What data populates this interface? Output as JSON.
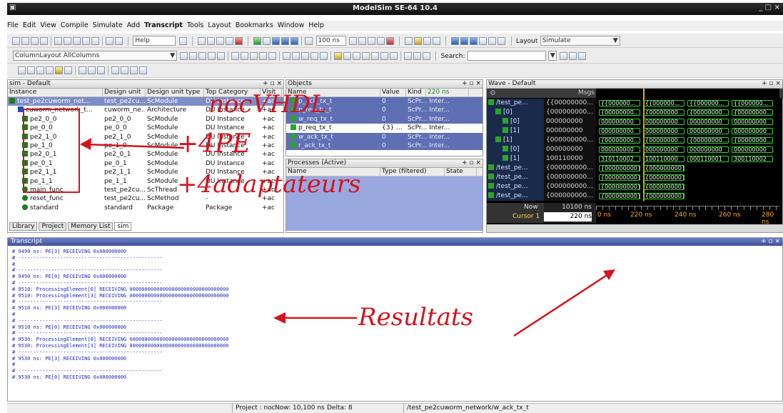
{
  "window": {
    "title": "ModelSim SE-64 10.4",
    "controls": "_ □ ×"
  },
  "menu": [
    "File",
    "Edit",
    "View",
    "Compile",
    "Simulate",
    "Add",
    "Transcript",
    "Tools",
    "Layout",
    "Bookmarks",
    "Window",
    "Help"
  ],
  "toolbar": {
    "help_label": "Help",
    "runtime_value": "100 ns",
    "layout_label": "Layout",
    "layout_value": "Simulate",
    "column_layout_value": "ColumnLayout AllColumns",
    "search_label": "Search:"
  },
  "sim_pane": {
    "title": "sim - Default",
    "columns": [
      "Instance",
      "Design unit",
      "Design unit type",
      "Top Category",
      "Visit"
    ],
    "rows": [
      {
        "instance": "test_pe2cuworm_net...",
        "unit": "test_pe2cu...",
        "type": "ScModule",
        "cat": "DU Instance",
        "vis": "+ac"
      },
      {
        "instance": "cuworm_network_t...",
        "unit": "cuworm_ne...",
        "type": "Architecture",
        "cat": "DU Instance",
        "vis": "+ac"
      },
      {
        "instance": "pe2_0_0",
        "unit": "pe2_0_0",
        "type": "ScModule",
        "cat": "DU Instance",
        "vis": "+ac"
      },
      {
        "instance": "pe_0_0",
        "unit": "pe_0_0",
        "type": "ScModule",
        "cat": "DU Instance",
        "vis": "+ac"
      },
      {
        "instance": "pe2_1_0",
        "unit": "pe2_1_0",
        "type": "ScModule",
        "cat": "DU Instance",
        "vis": "+ac"
      },
      {
        "instance": "pe_1_0",
        "unit": "pe_1_0",
        "type": "ScModule",
        "cat": "DU Instance",
        "vis": "+ac"
      },
      {
        "instance": "pe2_0_1",
        "unit": "pe2_0_1",
        "type": "ScModule",
        "cat": "DU Instance",
        "vis": "+ac"
      },
      {
        "instance": "pe_0_1",
        "unit": "pe_0_1",
        "type": "ScModule",
        "cat": "DU Instance",
        "vis": "+ac"
      },
      {
        "instance": "pe2_1_1",
        "unit": "pe2_1_1",
        "type": "ScModule",
        "cat": "DU Instance",
        "vis": "+ac"
      },
      {
        "instance": "pe_1_1",
        "unit": "pe_1_1",
        "type": "ScModule",
        "cat": "DU Instance",
        "vis": "+ac"
      },
      {
        "instance": "main_func",
        "unit": "test_pe2cu...",
        "type": "ScThread",
        "cat": "-",
        "vis": "+ac"
      },
      {
        "instance": "reset_func",
        "unit": "test_pe2cu...",
        "type": "ScMethod",
        "cat": "-",
        "vis": "+ac"
      },
      {
        "instance": "standard",
        "unit": "standard",
        "type": "Package",
        "cat": "Package",
        "vis": "+ac"
      }
    ],
    "tabs": [
      "Library",
      "Project",
      "Memory List",
      "sim"
    ]
  },
  "objects_pane": {
    "title": "Objects",
    "columns": [
      "Name",
      "Value",
      "Kind"
    ],
    "now": "220 ns",
    "rows": [
      {
        "name": "p_ack_tx_t",
        "value": "0",
        "kind": "ScPr... Inter..."
      },
      {
        "name": "p_req_tx_t",
        "value": "0",
        "kind": "ScPr... Inter..."
      },
      {
        "name": "w_req_tx_t",
        "value": "0",
        "kind": "ScPr... Inter..."
      },
      {
        "name": "p_req_tx_t",
        "value": "{3} ...",
        "kind": "ScPr... Inter..."
      },
      {
        "name": "w_ack_tx_t",
        "value": "0",
        "kind": "ScPr... Inter..."
      },
      {
        "name": "r_ack_tx_t",
        "value": "0",
        "kind": "ScPr... Inter..."
      }
    ]
  },
  "processes_pane": {
    "title": "Processes (Active)",
    "columns": [
      "Name",
      "Type (filtered)",
      "State"
    ]
  },
  "wave_pane": {
    "title": "Wave - Default",
    "msgs_label": "Msgs",
    "signals": [
      {
        "name": "/test_pe...",
        "value": "{{00000000..."
      },
      {
        "name": "[0]",
        "value": "{000000000..."
      },
      {
        "name": "[0]",
        "value": "000000000"
      },
      {
        "name": "[1]",
        "value": "000000000"
      },
      {
        "name": "[1]",
        "value": "{000000000..."
      },
      {
        "name": "[0]",
        "value": "000000000"
      },
      {
        "name": "[1]",
        "value": "100110000"
      },
      {
        "name": "/test_pe...",
        "value": "{000000000..."
      },
      {
        "name": "/test_pe...",
        "value": "{000000000..."
      },
      {
        "name": "/test_pe...",
        "value": "{000000000..."
      },
      {
        "name": "/test_pe...",
        "value": "{000000000..."
      }
    ],
    "wave_values": [
      [
        "{{000000...",
        "{{000000...",
        "{{000000...",
        "{{000000..."
      ],
      [
        "{00000000...",
        "{00000000...",
        "{00000000...",
        "{00000000..."
      ],
      [
        "000000000",
        "000000000",
        "000000000",
        "000000000"
      ],
      [
        "000000000",
        "000000000",
        "000000000",
        "000000000"
      ],
      [
        "{00000000...",
        "{00000000...",
        "{00000000...",
        "{00000000..."
      ],
      [
        "000000000",
        "000000000",
        "000000000",
        "000000000"
      ],
      [
        "310110002",
        "100110000",
        "000110001",
        "300110002"
      ],
      [
        "{000000000}",
        "{000000000}"
      ],
      [
        "{000000000}",
        "{000000000}"
      ],
      [
        "{000000000}",
        "{000000000}"
      ],
      [
        "{000000000}",
        "{000000000}"
      ]
    ],
    "now_label": "Now",
    "now_value": "10100 ns",
    "cursor_label": "Cursor 1",
    "cursor_value": "220 ns",
    "timeline": [
      "0 ns",
      "220 ns",
      "240 ns",
      "260 ns",
      "280 ns"
    ]
  },
  "transcript": {
    "title": "Transcript",
    "lines": [
      "# 9490 ns: PE[3] RECEIVING 0x000000000",
      "# ------------------------------------------------",
      "#",
      "# ------------------------------------------------",
      "# 9490 ns: PE[0] RECEIVING 0x000000000",
      "# ------------------------------------------------",
      "# 9510: ProcessingElement[0] RECEIVING 000000000000000000000000000000000",
      "# 9510: ProcessingElement[3] RECEIVING 000000000000000000000000000000000",
      "# ------------------------------------------------",
      "# 9510 ns: PE[3] RECEIVING 0x000000000",
      "#",
      "# ------------------------------------------------",
      "# 9510 ns: PE[0] RECEIVING 0x000000000",
      "# ------------------------------------------------",
      "# 9530: ProcessingElement[0] RECEIVING 000000000000000000000000000000000",
      "# 9530: ProcessingElement[3] RECEIVING 000000000000000000000000000000000",
      "# ------------------------------------------------",
      "# 9530 ns: PE[3] RECEIVING 0x000000000",
      "#",
      "# ------------------------------------------------",
      "# 9530 ns: PE[0] RECEIVING 0x000000000"
    ]
  },
  "statusbar": {
    "project": "Project : noc",
    "now": "Now: 10,100 ns",
    "delta": "Delta: 8",
    "path": "/test_pe2cuworm_network/w_ack_tx_t"
  },
  "annotations": {
    "noc": "nocVHDL",
    "pe": "+4PE",
    "adapters": "+4adaptateurs",
    "results": "Resultats",
    "color": "#d2141e"
  }
}
